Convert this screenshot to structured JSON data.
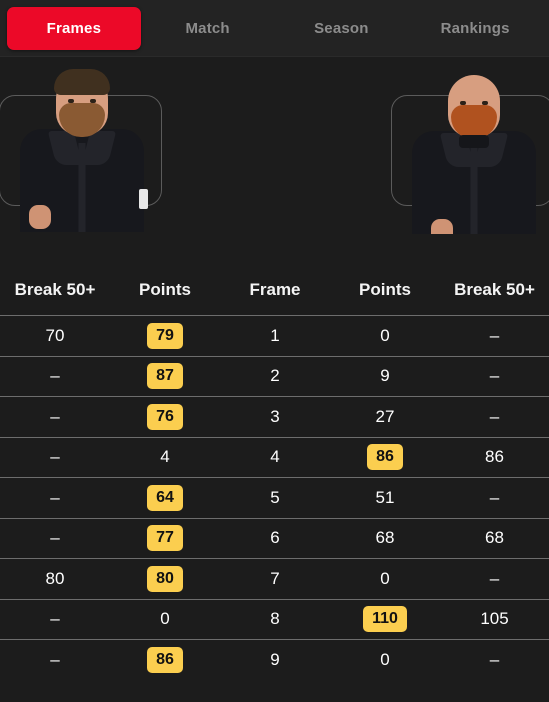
{
  "theme": {
    "background": "#1c1c1c",
    "tabbar_background": "#232323",
    "active_tab_color": "#ec0928",
    "inactive_tab_color": "#8c8c8c",
    "highlight_pill_color": "#fbce4f",
    "row_divider_color": "#6d6d6d",
    "text_color": "#ffffff"
  },
  "tabs": [
    {
      "label": "Frames",
      "active": true
    },
    {
      "label": "Match",
      "active": false
    },
    {
      "label": "Season",
      "active": false
    },
    {
      "label": "Rankings",
      "active": false
    }
  ],
  "players": {
    "left": {
      "photo_alt": "snooker-player-photo-left"
    },
    "right": {
      "photo_alt": "snooker-player-photo-right"
    }
  },
  "table": {
    "headers": [
      "Break 50+",
      "Points",
      "Frame",
      "Points",
      "Break 50+"
    ],
    "rows": [
      {
        "left_break": "70",
        "left_points": "79",
        "left_win": true,
        "frame": "1",
        "right_points": "0",
        "right_win": false,
        "right_break": "–"
      },
      {
        "left_break": "–",
        "left_points": "87",
        "left_win": true,
        "frame": "2",
        "right_points": "9",
        "right_win": false,
        "right_break": "–"
      },
      {
        "left_break": "–",
        "left_points": "76",
        "left_win": true,
        "frame": "3",
        "right_points": "27",
        "right_win": false,
        "right_break": "–"
      },
      {
        "left_break": "–",
        "left_points": "4",
        "left_win": false,
        "frame": "4",
        "right_points": "86",
        "right_win": true,
        "right_break": "86"
      },
      {
        "left_break": "–",
        "left_points": "64",
        "left_win": true,
        "frame": "5",
        "right_points": "51",
        "right_win": false,
        "right_break": "–"
      },
      {
        "left_break": "–",
        "left_points": "77",
        "left_win": true,
        "frame": "6",
        "right_points": "68",
        "right_win": false,
        "right_break": "68"
      },
      {
        "left_break": "80",
        "left_points": "80",
        "left_win": true,
        "frame": "7",
        "right_points": "0",
        "right_win": false,
        "right_break": "–"
      },
      {
        "left_break": "–",
        "left_points": "0",
        "left_win": false,
        "frame": "8",
        "right_points": "110",
        "right_win": true,
        "right_break": "105"
      },
      {
        "left_break": "–",
        "left_points": "86",
        "left_win": true,
        "frame": "9",
        "right_points": "0",
        "right_win": false,
        "right_break": "–"
      }
    ]
  }
}
